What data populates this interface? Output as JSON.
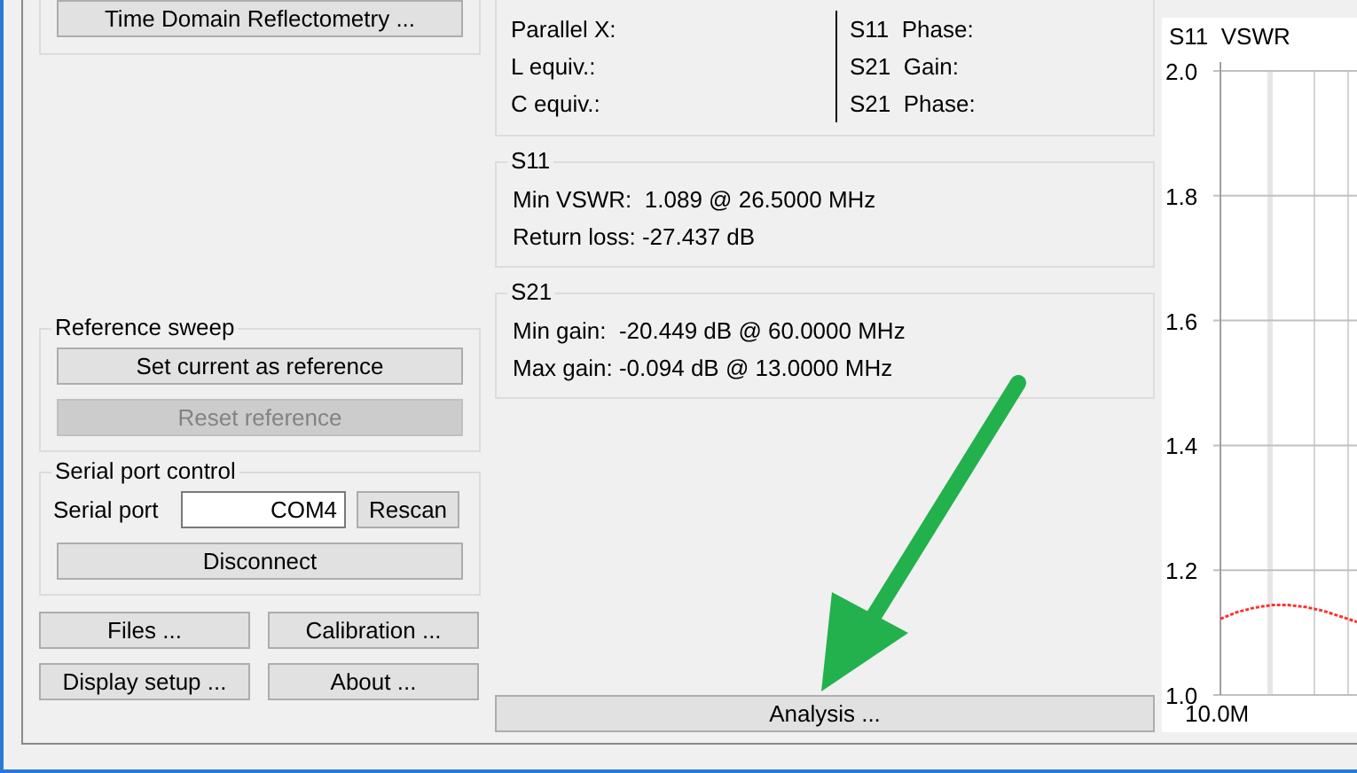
{
  "tdr_button": {
    "label": "Time Domain Reflectometry ..."
  },
  "reference_sweep": {
    "title": "Reference sweep",
    "buttons": [
      {
        "label": "Set current as reference",
        "disabled": false
      },
      {
        "label": "Reset reference",
        "disabled": true
      }
    ]
  },
  "serial_port": {
    "title": "Serial port control",
    "label": "Serial port",
    "value": "COM4",
    "rescan_button": "Rescan",
    "disconnect_button": "Disconnect"
  },
  "bottom_buttons": [
    "Files ...",
    "Calibration ...",
    "Display setup ...",
    "About ..."
  ],
  "marker_info": {
    "left": [
      "Parallel X:",
      "L equiv.:",
      "C equiv.:"
    ],
    "right": [
      "S11  Phase:",
      "S21  Gain:",
      "S21  Phase:"
    ]
  },
  "s11": {
    "title": "S11",
    "lines": [
      "Min VSWR:  1.089 @ 26.5000 MHz",
      "Return loss: -27.437 dB"
    ]
  },
  "s21": {
    "title": "S21",
    "lines": [
      "Min gain:  -20.449 dB @ 60.0000 MHz",
      "Max gain: -0.094 dB @ 13.0000 MHz"
    ]
  },
  "analysis_button": "Analysis ...",
  "chart": {
    "start_label": "10.0M",
    "chart_data": {
      "type": "line",
      "title": "S11  VSWR",
      "ylim": [
        1.0,
        2.0
      ],
      "yticks": [
        {
          "value": 1.0,
          "label": "1.0"
        },
        {
          "value": 1.2,
          "label": "1.2"
        },
        {
          "value": 1.4,
          "label": "1.4"
        },
        {
          "value": 1.6,
          "label": "1.6"
        },
        {
          "value": 1.8,
          "label": "1.8"
        },
        {
          "value": 2.0,
          "label": "2.0"
        }
      ],
      "grid": true,
      "series": [
        {
          "color": "#ff3030",
          "line_style": "dotted",
          "values": [
            1.122,
            1.133,
            1.14,
            1.144,
            1.144,
            1.141,
            1.135,
            1.126,
            1.117
          ]
        }
      ]
    }
  }
}
